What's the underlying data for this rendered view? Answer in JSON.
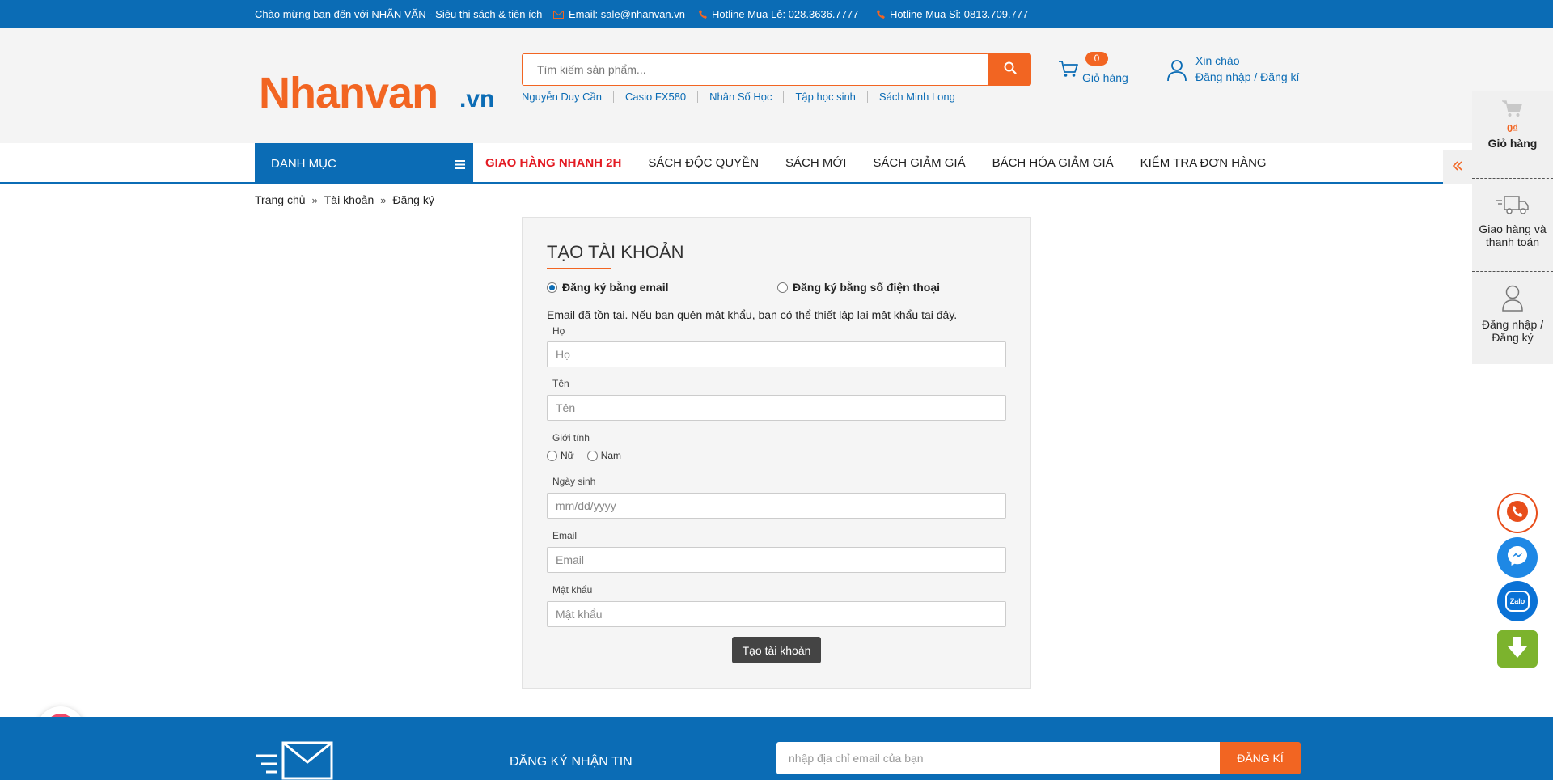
{
  "topbar": {
    "welcome": "Chào mừng bạn đến với NHÃN VĂN - Siêu thị sách & tiện ích",
    "email": "Email: sale@nhanvan.vn",
    "hotline_retail": "Hotline Mua Lẻ: 028.3636.7777",
    "hotline_wholesale": "Hotline Mua Sỉ: 0813.709.777"
  },
  "header": {
    "logo_main": "Nhanvan",
    "logo_suffix": ".vn",
    "search_placeholder": "Tìm kiếm sản phẩm...",
    "quick_links": [
      "Nguyễn Duy Cần",
      "Casio FX580",
      "Nhân Số Học",
      "Tập học sinh",
      "Sách Minh Long"
    ],
    "cart_count": "0",
    "cart_label": "Giỏ hàng",
    "greeting": "Xin chào",
    "login_register": "Đăng nhập / Đăng kí"
  },
  "nav": {
    "category_label": "DANH MỤC",
    "items": [
      "GIAO HÀNG NHANH 2H",
      "SÁCH ĐỘC QUYỀN",
      "SÁCH MỚI",
      "SÁCH GIẢM GIÁ",
      "BÁCH HÓA GIẢM GIÁ",
      "KIỂM TRA ĐƠN HÀNG"
    ]
  },
  "breadcrumb": {
    "home": "Trang chủ",
    "account": "Tài khoản",
    "current": "Đăng ký"
  },
  "form": {
    "title": "TẠO TÀI KHOẢN",
    "option_email": "Đăng ký bằng email",
    "option_phone": "Đăng ký bằng số điện thoại",
    "selected_option": "email",
    "notice": "Email đã tồn tại. Nếu bạn quên mật khẩu, bạn có thể thiết lập lại mật khẩu tại đây.",
    "last_name_label": "Họ",
    "last_name_placeholder": "Họ",
    "first_name_label": "Tên",
    "first_name_placeholder": "Tên",
    "gender_label": "Giới tính",
    "gender_female": "Nữ",
    "gender_male": "Nam",
    "dob_label": "Ngày sinh",
    "dob_placeholder": "mm/dd/yyyy",
    "email_label": "Email",
    "email_placeholder": "Email",
    "password_label": "Mật khẩu",
    "password_placeholder": "Mật khẩu",
    "submit_label": "Tạo tài khoản"
  },
  "sidebar": {
    "cart_amount": "0₫",
    "cart_label": "Giỏ hàng",
    "shipping_line1": "Giao hàng và",
    "shipping_line2": "thanh toán",
    "login_line1": "Đăng nhập /",
    "login_line2": "Đăng ký"
  },
  "floating": {
    "zalo_text": "Zalo",
    "icons": [
      "phone-icon",
      "messenger-icon",
      "zalo-icon",
      "download-icon",
      "heart-icon"
    ]
  },
  "footer": {
    "newsletter_title": "ĐĂNG KÝ NHẬN TIN",
    "newsletter_placeholder": "nhập địa chỉ email của bạn",
    "newsletter_button": "ĐĂNG KÍ"
  },
  "colors": {
    "primary_blue": "#0b6cb5",
    "accent_orange": "#f26522",
    "hot_red": "#e31b23"
  }
}
